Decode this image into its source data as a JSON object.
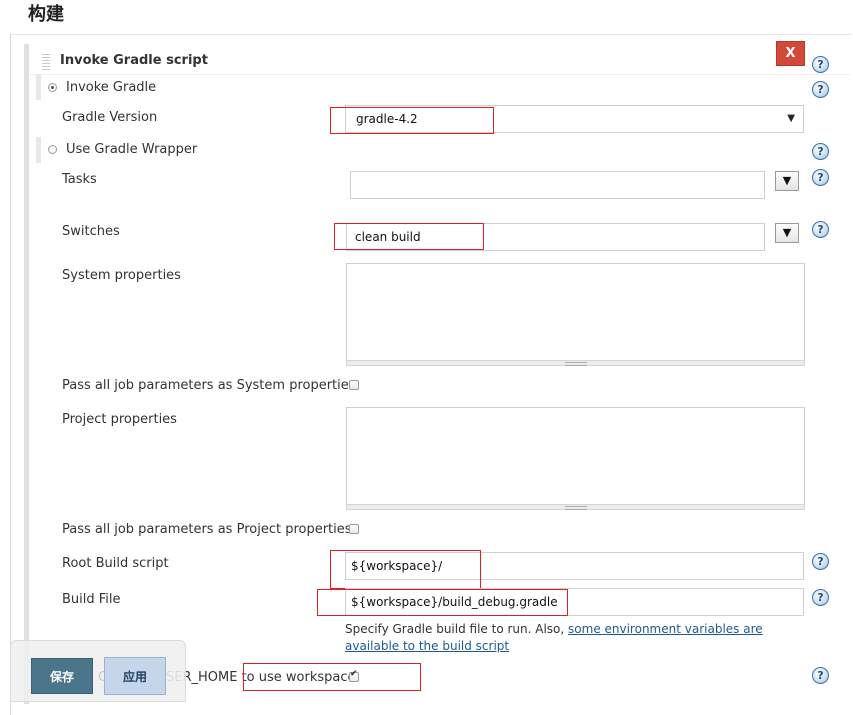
{
  "section": {
    "title": "构建"
  },
  "step": {
    "title": "Invoke Gradle script",
    "close_label": "X",
    "help_glyph": "?"
  },
  "invoke_gradle": {
    "option_label": "Invoke Gradle",
    "version_label": "Gradle Version",
    "version_value": "gradle-4.2",
    "selected": true
  },
  "wrapper": {
    "option_label": "Use Gradle Wrapper",
    "selected": false
  },
  "tasks": {
    "label": "Tasks",
    "value": "",
    "dropdown_glyph": "▼"
  },
  "switches": {
    "label": "Switches",
    "value": "clean build",
    "dropdown_glyph": "▼"
  },
  "system_properties": {
    "label": "System properties",
    "value": ""
  },
  "pass_system": {
    "label": "Pass all job parameters as System properties",
    "checked": false
  },
  "project_properties": {
    "label": "Project properties",
    "value": ""
  },
  "pass_project": {
    "label": "Pass all job parameters as Project properties",
    "checked": false
  },
  "root_build_script": {
    "label": "Root Build script",
    "value": "${workspace}/"
  },
  "build_file": {
    "label": "Build File",
    "value": "${workspace}/build_debug.gradle",
    "help_prefix": "Specify Gradle build file to run. Also, ",
    "help_link": "some environment variables are available to the build script"
  },
  "user_home": {
    "label_partial": "SER_HOME to use workspace",
    "checked": true
  },
  "buttons": {
    "save": "保存",
    "apply": "应用",
    "hidden_text": "C"
  },
  "colors": {
    "close": "#d24939",
    "save": "#4b758b",
    "apply": "#c5d6ea",
    "highlight": "#e02020"
  }
}
